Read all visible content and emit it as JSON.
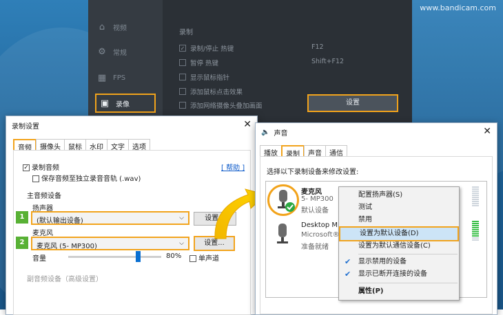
{
  "watermark": "www.bandicam.com",
  "bandicam": {
    "nav": [
      {
        "label": "视频",
        "icon": "home-icon"
      },
      {
        "label": "常规",
        "icon": "gear-icon"
      },
      {
        "label": "FPS",
        "icon": "fps-icon"
      },
      {
        "label": "录像",
        "icon": "video-icon"
      }
    ],
    "section": "录制",
    "options": [
      {
        "label": "录制/停止 热键",
        "checked": true,
        "hotkey": "F12"
      },
      {
        "label": "暂停 热键",
        "checked": false,
        "hotkey": "Shift+F12"
      },
      {
        "label": "显示鼠标指针",
        "checked": false
      },
      {
        "label": "添加鼠标点击效果",
        "checked": false
      },
      {
        "label": "添加网络摄像头叠加画面",
        "checked": false
      }
    ],
    "settings_btn": "设置"
  },
  "rec": {
    "title": "录制设置",
    "tabs": [
      "音频",
      "摄像头",
      "鼠标",
      "水印",
      "文字",
      "选项"
    ],
    "record_audio": "录制音频",
    "help": "[ 帮助 ]",
    "save_track": "保存音频至独立录音音轨 (.wav)",
    "main_group": "主音频设备",
    "speaker_label": "扬声器",
    "speaker_value": "(默认输出设备)",
    "settings_btn": "设置...",
    "mic_label": "麦克风",
    "mic_value": "麦克风 (5- MP300)",
    "settings_btn2": "设置...",
    "volume": "音量",
    "volume_pct": "80%",
    "volume_level": 0.8,
    "mono": "单声道",
    "secondary": "副音频设备（高级设置）",
    "step1": "1",
    "step2": "2"
  },
  "sound": {
    "title": "声音",
    "tabs": [
      "播放",
      "录制",
      "声音",
      "通信"
    ],
    "instruction": "选择以下录制设备来修改设置:",
    "devices": [
      {
        "name": "麦克风",
        "sub": "5- MP300",
        "status": "默认设备"
      },
      {
        "name": "Desktop Mi",
        "sub": "Microsoft®",
        "status": "准备就绪"
      }
    ],
    "menu": {
      "items": [
        "配置扬声器(S)",
        "测试",
        "禁用",
        "设置为默认设备(D)",
        "设置为默认通信设备(C)",
        "显示禁用的设备",
        "显示已断开连接的设备",
        "属性(P)"
      ]
    }
  },
  "colors": {
    "accent": "#f2a31b",
    "badge": "#58b135",
    "highlight": "#cce4f7"
  }
}
